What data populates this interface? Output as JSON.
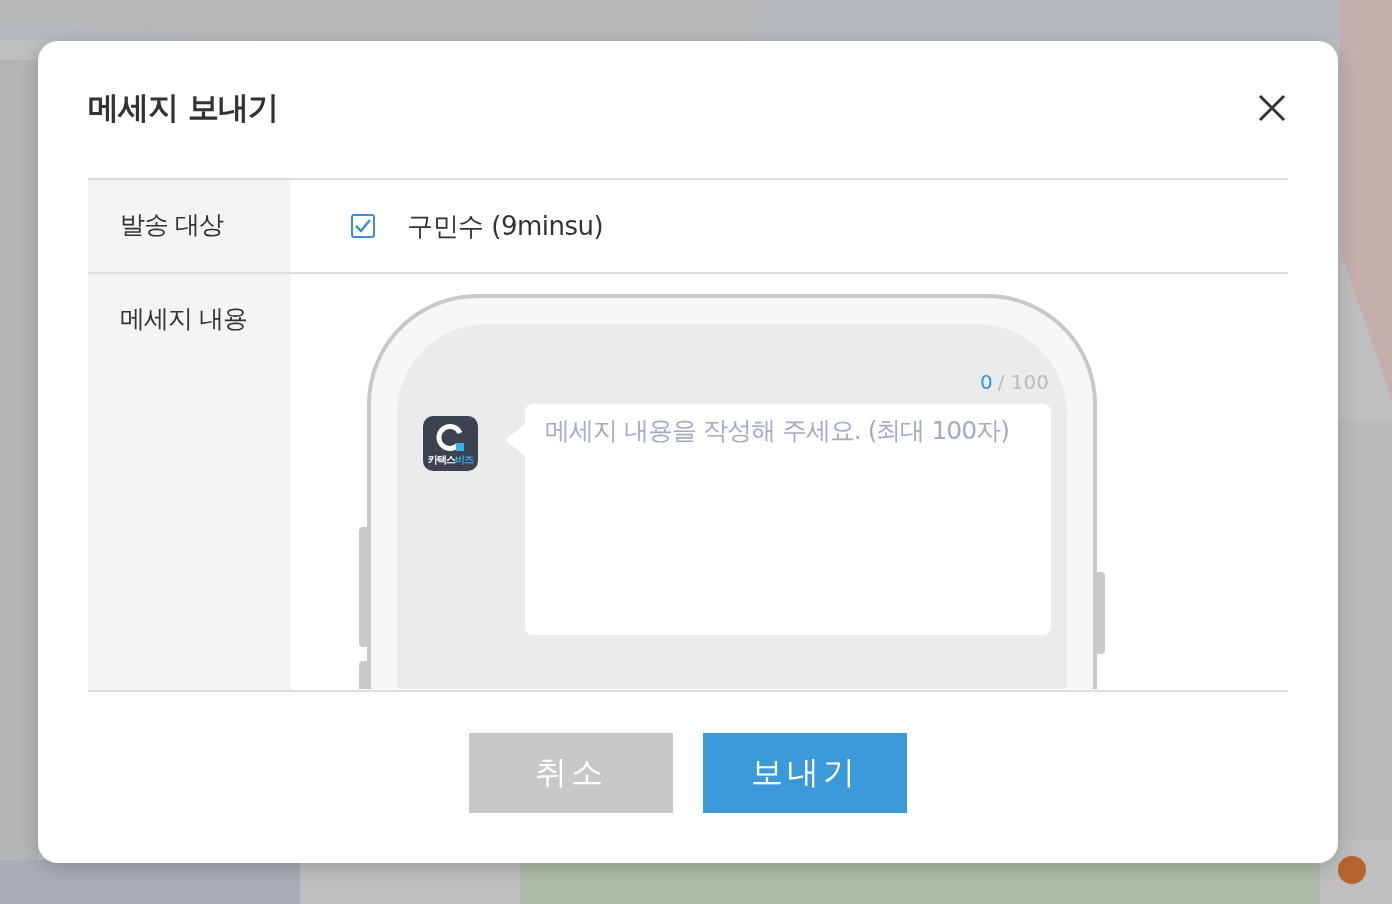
{
  "dialog": {
    "title": "메세지 보내기"
  },
  "recipient": {
    "label": "발송 대상",
    "name": "구민수 (9minsu)",
    "checked": true
  },
  "message": {
    "label": "메세지 내용",
    "count": "0",
    "limit": "/ 100",
    "placeholder": "메세지 내용을 작성해 주세요. (최대 100자)",
    "logo_text": [
      "카택스",
      "비즈"
    ]
  },
  "buttons": [
    {
      "kind": "cancel",
      "label": "취소"
    },
    {
      "kind": "send",
      "label": "보내기"
    }
  ]
}
